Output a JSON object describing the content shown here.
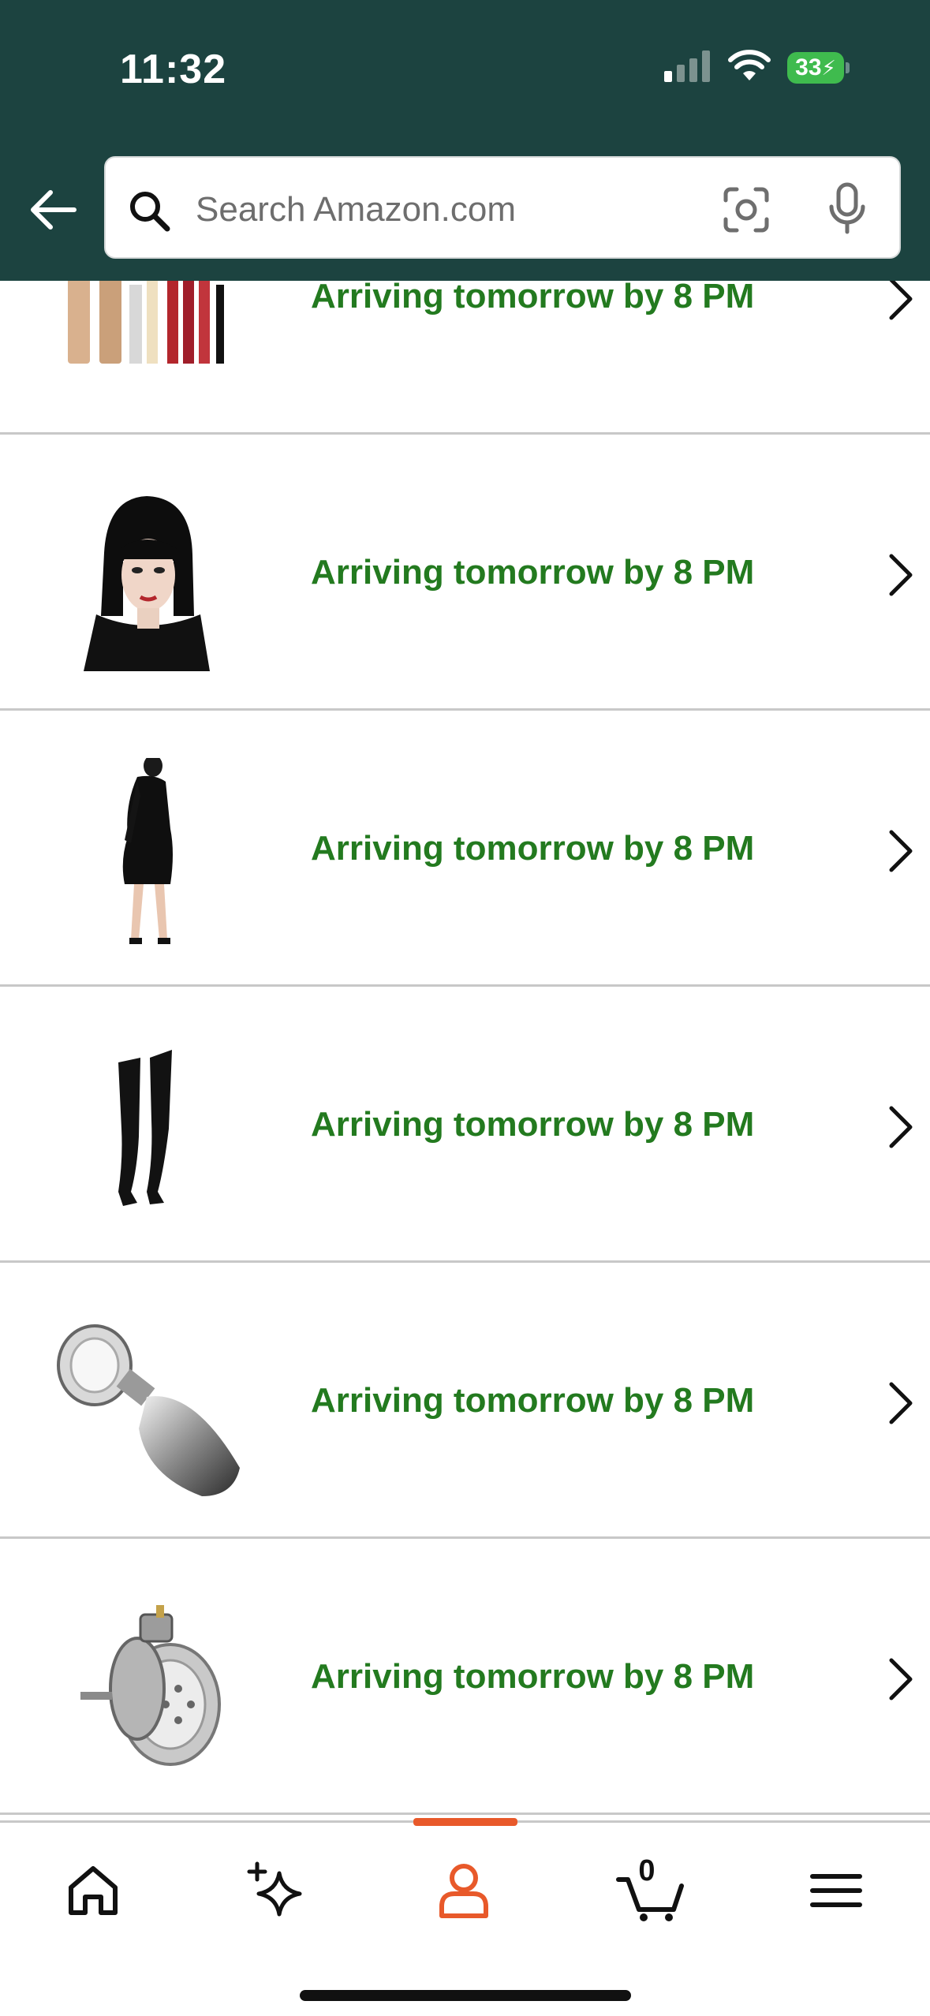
{
  "status_bar": {
    "time": "11:32",
    "battery": "33"
  },
  "search": {
    "placeholder": "Search Amazon.com"
  },
  "orders": [
    {
      "status": "Arriving tomorrow by 8 PM",
      "item": "makeup-set-thumbnail"
    },
    {
      "status": "Arriving tomorrow by 8 PM",
      "item": "black-bob-wig-thumbnail"
    },
    {
      "status": "Arriving tomorrow by 8 PM",
      "item": "black-bodycon-dress-thumbnail"
    },
    {
      "status": "Arriving tomorrow by 8 PM",
      "item": "black-thigh-high-stockings-thumbnail"
    },
    {
      "status": "Arriving tomorrow by 8 PM",
      "item": "steel-jeweled-plug-thumbnail"
    },
    {
      "status": "Arriving tomorrow by 8 PM",
      "item": "metal-chastity-device-thumbnail"
    }
  ],
  "bottom_nav": {
    "items": [
      "home-icon",
      "sparkle-icon",
      "account-icon",
      "cart-icon",
      "menu-icon"
    ],
    "active": "account-icon",
    "cart_count": "0"
  },
  "colors": {
    "header_bg": "#1c4340",
    "delivery_text": "#237a1f",
    "active_accent": "#e8592a",
    "battery": "#3fbb4e"
  }
}
